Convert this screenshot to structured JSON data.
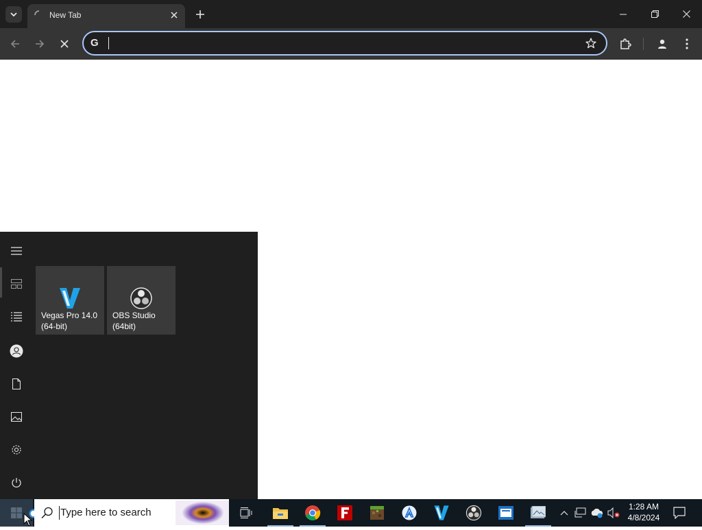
{
  "browser": {
    "tab_title": "New Tab",
    "address_value": "",
    "colors": {
      "titlebar": "#1f1f1f",
      "toolbar": "#353535",
      "omnibox_border": "#a8c7fa"
    }
  },
  "start_menu": {
    "rail_icons": [
      "hamburger-icon",
      "tiles-icon",
      "all-apps-icon",
      "user-icon",
      "documents-icon",
      "pictures-icon",
      "settings-icon",
      "power-icon"
    ],
    "tiles": [
      {
        "label": "Vegas Pro 14.0\n(64-bit)",
        "icon": "vegas-pro-icon"
      },
      {
        "label": "OBS Studio\n(64bit)",
        "icon": "obs-studio-icon"
      }
    ]
  },
  "taskbar": {
    "search_placeholder": "Type here to search",
    "apps": [
      "task-view-icon",
      "file-explorer-icon",
      "chrome-icon",
      "filezilla-icon",
      "minecraft-icon",
      "app-installer-icon",
      "vegas-pro-icon",
      "obs-studio-icon",
      "outlook-icon",
      "photos-icon"
    ],
    "time": "1:28 AM",
    "date": "4/8/2024"
  }
}
